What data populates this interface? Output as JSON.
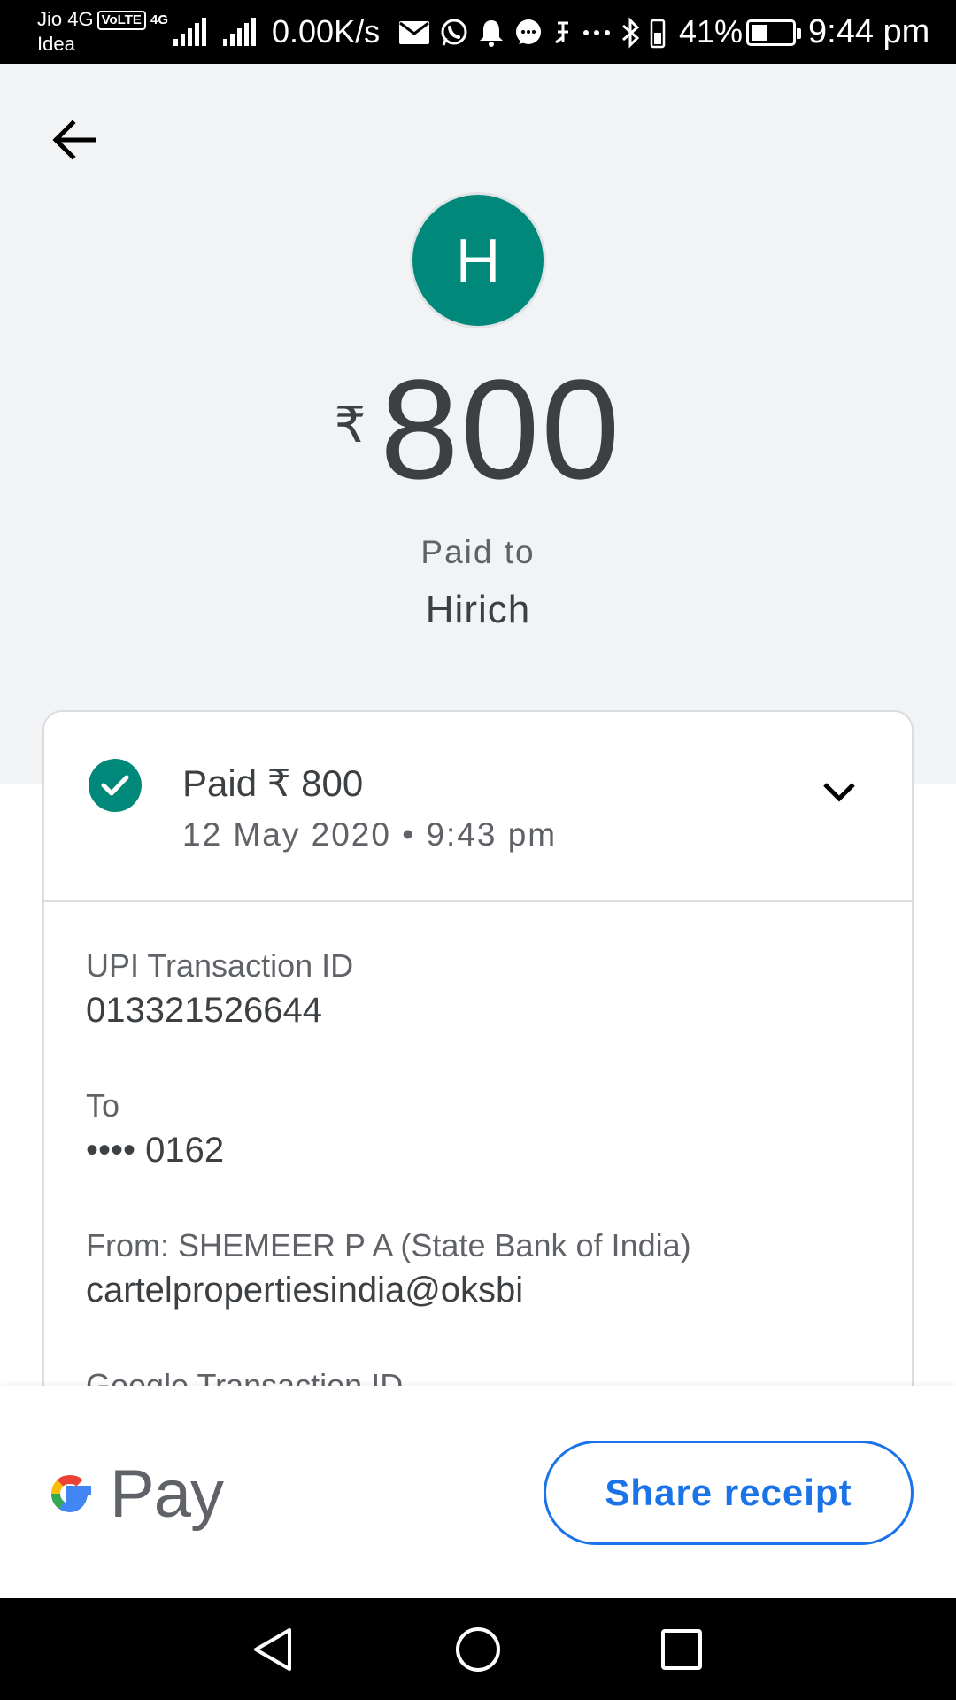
{
  "status_bar": {
    "carrier_primary": "Jio 4G",
    "volte": "VoLTE",
    "network_4g": "4G",
    "carrier_secondary": "Idea",
    "net_speed": "0.00K/s",
    "battery_percent": "41%",
    "time": "9:44 pm",
    "battery_level": 0.41
  },
  "header": {
    "back_icon": "arrow-left-icon",
    "avatar_initial": "H",
    "avatar_color": "#00897b",
    "currency_symbol": "₹",
    "amount": "800",
    "paid_to_label": "Paid to",
    "payee_name": "Hirich"
  },
  "card": {
    "status_icon": "check-circle-icon",
    "status_color": "#00897b",
    "summary_title": "Paid ₹ 800",
    "summary_datetime": "12 May 2020 • 9:43 pm",
    "expand_icon": "chevron-down-icon",
    "details": [
      {
        "label": "UPI Transaction ID",
        "value": "013321526644"
      },
      {
        "label": "To",
        "value": "•••• 0162"
      },
      {
        "label": "From: SHEMEER  P A (State Bank of India)",
        "value": "cartelpropertiesindia@oksbi"
      },
      {
        "label": "Google Transaction ID",
        "value": ""
      }
    ]
  },
  "footer": {
    "brand_text": "Pay",
    "share_button_label": "Share receipt",
    "accent_color": "#1a73e8"
  },
  "nav_bar": {
    "back": "nav-back-icon",
    "home": "nav-home-icon",
    "recents": "nav-recents-icon"
  }
}
